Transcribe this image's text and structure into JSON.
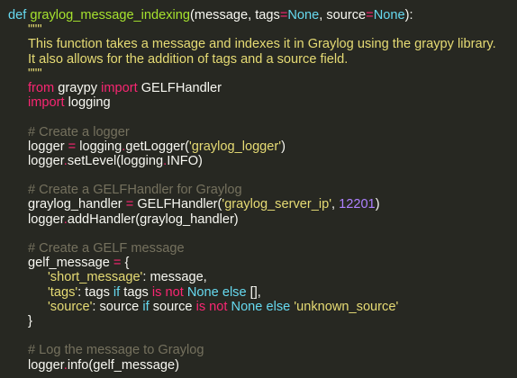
{
  "colors": {
    "background": "#272822",
    "keyword": "#66d9ef",
    "function": "#a6e22e",
    "string": "#e6db74",
    "operator": "#f92672",
    "comment": "#75715e",
    "number": "#ae81ff"
  },
  "lines": [
    {
      "indent": 0,
      "tokens": [
        [
          "kw",
          "def"
        ],
        [
          "pl",
          " "
        ],
        [
          "fn",
          "graylog_message_indexing"
        ],
        [
          "pl",
          "(message, tags"
        ],
        [
          "op",
          "="
        ],
        [
          "kw",
          "None"
        ],
        [
          "pl",
          ", source"
        ],
        [
          "op",
          "="
        ],
        [
          "kw",
          "None"
        ],
        [
          "pl",
          "):"
        ]
      ]
    },
    {
      "indent": 1,
      "tokens": [
        [
          "doc",
          "\"\"\""
        ]
      ]
    },
    {
      "indent": 1,
      "tokens": [
        [
          "doc",
          "This function takes a message and indexes it in Graylog using the graypy library."
        ]
      ]
    },
    {
      "indent": 1,
      "tokens": [
        [
          "doc",
          "It also allows for the addition of tags and a source field."
        ]
      ]
    },
    {
      "indent": 1,
      "tokens": [
        [
          "doc",
          "\"\"\""
        ]
      ]
    },
    {
      "indent": 1,
      "tokens": [
        [
          "op",
          "from"
        ],
        [
          "pl",
          " graypy "
        ],
        [
          "op",
          "import"
        ],
        [
          "pl",
          " GELFHandler"
        ]
      ]
    },
    {
      "indent": 1,
      "tokens": [
        [
          "op",
          "import"
        ],
        [
          "pl",
          " logging"
        ]
      ]
    },
    {
      "indent": 0,
      "tokens": []
    },
    {
      "indent": 1,
      "tokens": [
        [
          "cm",
          "# Create a logger"
        ]
      ]
    },
    {
      "indent": 1,
      "tokens": [
        [
          "pl",
          "logger "
        ],
        [
          "op",
          "="
        ],
        [
          "pl",
          " logging"
        ],
        [
          "op",
          "."
        ],
        [
          "pl",
          "getLogger("
        ],
        [
          "str",
          "'graylog_logger'"
        ],
        [
          "pl",
          ")"
        ]
      ]
    },
    {
      "indent": 1,
      "tokens": [
        [
          "pl",
          "logger"
        ],
        [
          "op",
          "."
        ],
        [
          "pl",
          "setLevel(logging"
        ],
        [
          "op",
          "."
        ],
        [
          "pl",
          "INFO)"
        ]
      ]
    },
    {
      "indent": 0,
      "tokens": []
    },
    {
      "indent": 1,
      "tokens": [
        [
          "cm",
          "# Create a GELFHandler for Graylog"
        ]
      ]
    },
    {
      "indent": 1,
      "tokens": [
        [
          "pl",
          "graylog_handler "
        ],
        [
          "op",
          "="
        ],
        [
          "pl",
          " GELFHandler("
        ],
        [
          "str",
          "'graylog_server_ip'"
        ],
        [
          "pl",
          ", "
        ],
        [
          "num",
          "12201"
        ],
        [
          "pl",
          ")"
        ]
      ]
    },
    {
      "indent": 1,
      "tokens": [
        [
          "pl",
          "logger"
        ],
        [
          "op",
          "."
        ],
        [
          "pl",
          "addHandler(graylog_handler)"
        ]
      ]
    },
    {
      "indent": 0,
      "tokens": []
    },
    {
      "indent": 1,
      "tokens": [
        [
          "cm",
          "# Create a GELF message"
        ]
      ]
    },
    {
      "indent": 1,
      "tokens": [
        [
          "pl",
          "gelf_message "
        ],
        [
          "op",
          "="
        ],
        [
          "pl",
          " {"
        ]
      ]
    },
    {
      "indent": 2,
      "tokens": [
        [
          "str",
          "'short_message'"
        ],
        [
          "pl",
          ": message,"
        ]
      ]
    },
    {
      "indent": 2,
      "tokens": [
        [
          "str",
          "'tags'"
        ],
        [
          "pl",
          ": tags "
        ],
        [
          "kw",
          "if"
        ],
        [
          "pl",
          " tags "
        ],
        [
          "op",
          "is not"
        ],
        [
          "pl",
          " "
        ],
        [
          "kw",
          "None"
        ],
        [
          "pl",
          " "
        ],
        [
          "kw",
          "else"
        ],
        [
          "pl",
          " [],"
        ]
      ]
    },
    {
      "indent": 2,
      "tokens": [
        [
          "str",
          "'source'"
        ],
        [
          "pl",
          ": source "
        ],
        [
          "kw",
          "if"
        ],
        [
          "pl",
          " source "
        ],
        [
          "op",
          "is not"
        ],
        [
          "pl",
          " "
        ],
        [
          "kw",
          "None"
        ],
        [
          "pl",
          " "
        ],
        [
          "kw",
          "else"
        ],
        [
          "pl",
          " "
        ],
        [
          "str",
          "'unknown_source'"
        ]
      ]
    },
    {
      "indent": 1,
      "tokens": [
        [
          "pl",
          "}"
        ]
      ]
    },
    {
      "indent": 0,
      "tokens": []
    },
    {
      "indent": 1,
      "tokens": [
        [
          "cm",
          "# Log the message to Graylog"
        ]
      ]
    },
    {
      "indent": 1,
      "tokens": [
        [
          "pl",
          "logger"
        ],
        [
          "op",
          "."
        ],
        [
          "pl",
          "info(gelf_message)"
        ]
      ]
    }
  ]
}
